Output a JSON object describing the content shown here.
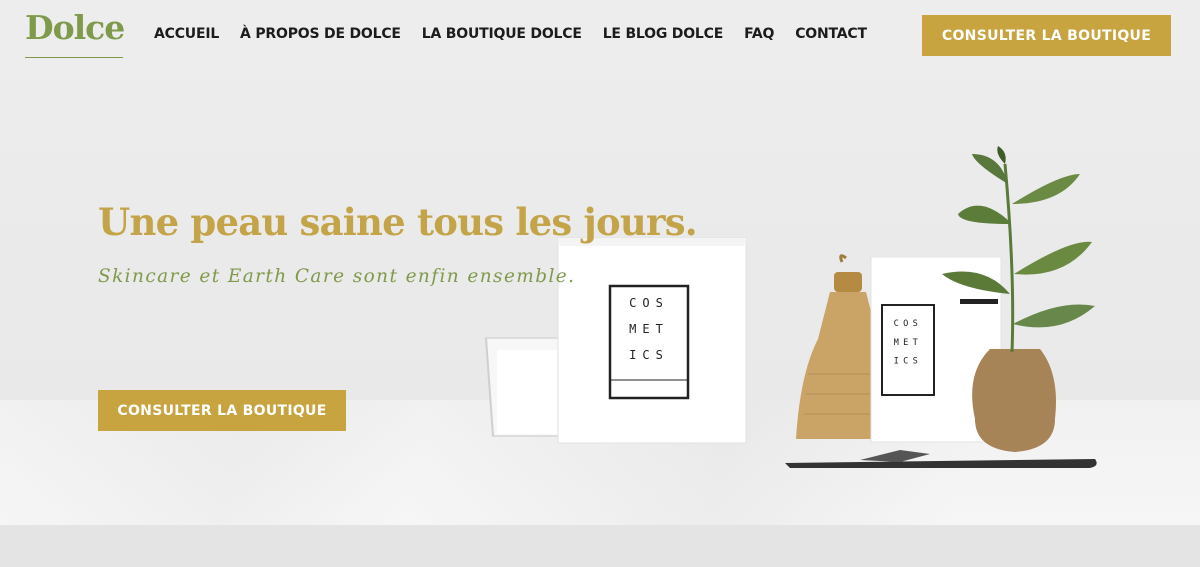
{
  "brand": {
    "logo": "Dolce"
  },
  "nav": {
    "items": [
      {
        "label": "ACCUEIL"
      },
      {
        "label": "À PROPOS DE DOLCE"
      },
      {
        "label": "LA BOUTIQUE DOLCE"
      },
      {
        "label": "LE BLOG DOLCE"
      },
      {
        "label": "FAQ"
      },
      {
        "label": "CONTACT"
      }
    ],
    "cta_label": "CONSULTER LA BOUTIQUE"
  },
  "hero": {
    "headline": "Une peau saine tous les jours.",
    "subheadline": "Skincare et Earth Care sont enfin ensemble.",
    "cta_label": "CONSULTER LA BOUTIQUE",
    "product_label_lines": [
      "COS",
      "MET",
      "ICS"
    ]
  },
  "colors": {
    "accent_gold": "#c7a43f",
    "brand_green": "#7e9a4a",
    "nav_text": "#1c1c1c"
  },
  "icons": [
    "logo-underline"
  ]
}
